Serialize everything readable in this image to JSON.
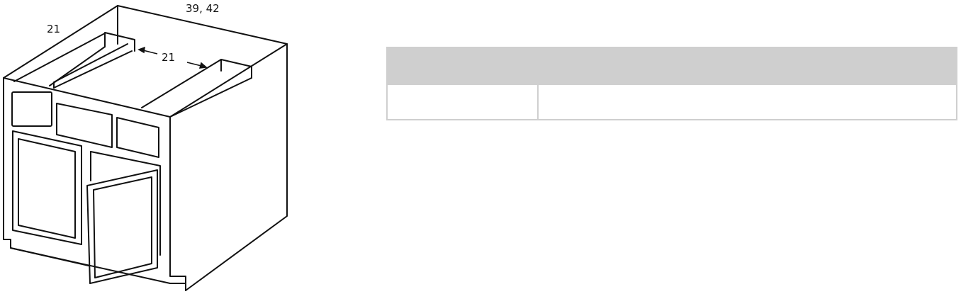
{
  "diagram": {
    "dimension_labels": {
      "depth": "21",
      "width": "39, 42",
      "interior_gap": "21"
    }
  },
  "spec_table": {
    "header": {
      "left": "",
      "right": ""
    },
    "rows": [
      {
        "left": "",
        "right": ""
      }
    ],
    "colors": {
      "header_fill": "#cfcfcf",
      "border": "#cfcfcf"
    }
  }
}
